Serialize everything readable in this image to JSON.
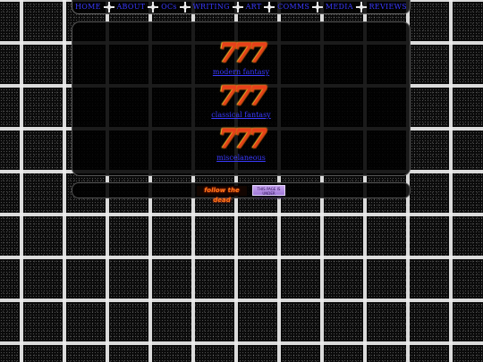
{
  "nav": {
    "items": [
      {
        "label": "HOME"
      },
      {
        "label": "ABOUT"
      },
      {
        "label": "OCs"
      },
      {
        "label": "WRITING"
      },
      {
        "label": "ART"
      },
      {
        "label": "COMMS"
      },
      {
        "label": "MEDIA"
      },
      {
        "label": "REVIEWS"
      }
    ]
  },
  "panel": {
    "entries": [
      {
        "icon": "777",
        "label": "modern fantasy"
      },
      {
        "icon": "777",
        "label": "classical fantasy"
      },
      {
        "icon": "777",
        "label": "miscelaneous"
      }
    ]
  },
  "footer": {
    "fire_button": "follow the dead",
    "purple_button": "THIS PAGE IS UNDER CONSTRUCTION"
  },
  "colors": {
    "link": "#3a3aff",
    "grid_line": "#ebebeb",
    "background": "#0a0a0a"
  }
}
